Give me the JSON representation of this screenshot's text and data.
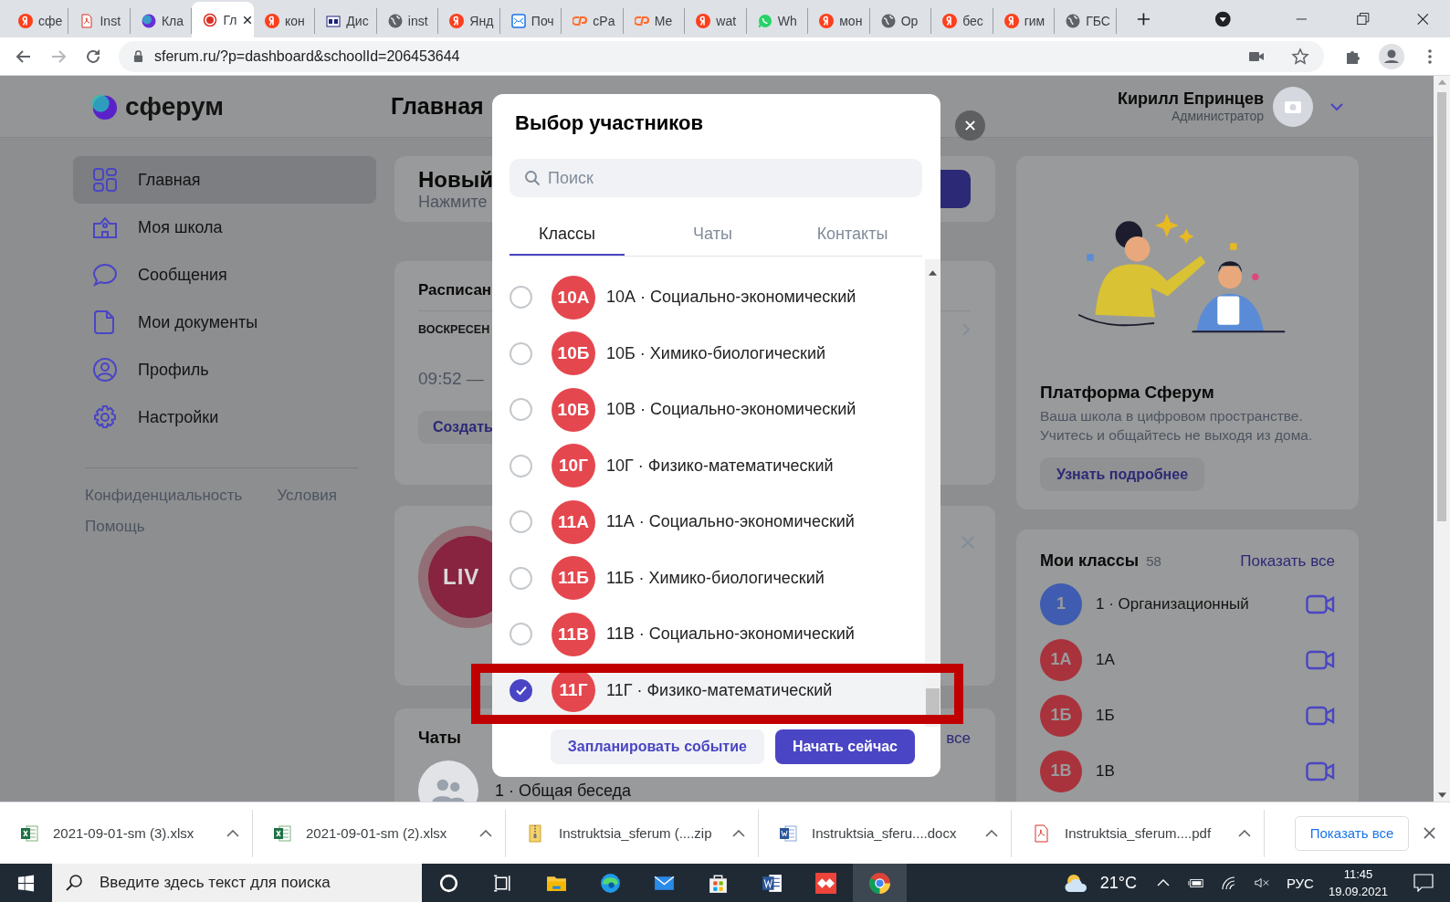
{
  "browser": {
    "tabs": [
      {
        "kind": "yandex",
        "label": "сфе",
        "selected": false
      },
      {
        "kind": "pdf",
        "label": "Inst",
        "selected": false
      },
      {
        "kind": "sferum",
        "label": "Кла",
        "selected": false
      },
      {
        "kind": "recording",
        "label": "Гл",
        "selected": true
      },
      {
        "kind": "yandex",
        "label": "кон",
        "selected": false
      },
      {
        "kind": "calendar",
        "label": "Дис",
        "selected": false
      },
      {
        "kind": "globe",
        "label": "inst",
        "selected": false
      },
      {
        "kind": "yandex",
        "label": "Янд",
        "selected": false
      },
      {
        "kind": "mail",
        "label": "Поч",
        "selected": false
      },
      {
        "kind": "cpanel",
        "label": "cPa",
        "selected": false
      },
      {
        "kind": "cpanel",
        "label": "Ме",
        "selected": false
      },
      {
        "kind": "yandex",
        "label": "wat",
        "selected": false
      },
      {
        "kind": "whatsapp",
        "label": "Wh",
        "selected": false
      },
      {
        "kind": "yandex",
        "label": "мон",
        "selected": false
      },
      {
        "kind": "globe",
        "label": "Ор",
        "selected": false
      },
      {
        "kind": "yandex",
        "label": "бес",
        "selected": false
      },
      {
        "kind": "yandex",
        "label": "гим",
        "selected": false
      },
      {
        "kind": "globe",
        "label": "ГБС",
        "selected": false
      }
    ],
    "address": "sferum.ru/?p=dashboard&schoolId=206453644"
  },
  "page": {
    "logo": "сферум",
    "title": "Главная",
    "user": {
      "name": "Кирилл Епринцев",
      "role": "Администратор"
    },
    "sidebar": {
      "items": [
        {
          "kind": "grid",
          "label": "Главная",
          "selected": true
        },
        {
          "kind": "school",
          "label": "Моя школа",
          "selected": false
        },
        {
          "kind": "chat",
          "label": "Сообщения",
          "selected": false
        },
        {
          "kind": "document",
          "label": "Мои документы",
          "selected": false
        },
        {
          "kind": "profile",
          "label": "Профиль",
          "selected": false
        },
        {
          "kind": "settings",
          "label": "Настройки",
          "selected": false
        }
      ],
      "links": [
        "Конфиденциальность",
        "Условия",
        "Помощь"
      ]
    },
    "new_call": {
      "title": "Новый",
      "hint": "Нажмите"
    },
    "schedule": {
      "title": "Расписан",
      "day": "ВОСКРЕСЕН",
      "time": "09:52 —",
      "button": "Создать"
    },
    "live": {
      "badge": "LIV"
    },
    "chats": {
      "title": "Чаты",
      "link": "все",
      "first": "1 · Общая беседа"
    },
    "promo": {
      "title": "Платформа Сферум",
      "text": "Ваша школа в цифровом пространстве. Учитесь и общайтесь не выходя из дома.",
      "button": "Узнать подробнее"
    },
    "classes": {
      "title": "Мои классы",
      "count": "58",
      "link": "Показать все",
      "items": [
        {
          "badge": "1",
          "name": "1 · Организационный",
          "color": "#3f5cb0"
        },
        {
          "badge": "1А",
          "name": "1А",
          "color": "#a8333c"
        },
        {
          "badge": "1Б",
          "name": "1Б",
          "color": "#a8333c"
        },
        {
          "badge": "1В",
          "name": "1В",
          "color": "#a8333c"
        }
      ]
    }
  },
  "dialog": {
    "title": "Выбор участников",
    "search_placeholder": "Поиск",
    "tabs": [
      {
        "label": "Классы",
        "selected": true
      },
      {
        "label": "Чаты",
        "selected": false
      },
      {
        "label": "Контакты",
        "selected": false
      }
    ],
    "rows": [
      {
        "badge": "10А",
        "name": "10А · Социально-экономический",
        "checked": false
      },
      {
        "badge": "10Б",
        "name": "10Б · Химико-биологический",
        "checked": false
      },
      {
        "badge": "10В",
        "name": "10В · Социально-экономический",
        "checked": false
      },
      {
        "badge": "10Г",
        "name": "10Г · Физико-математический",
        "checked": false
      },
      {
        "badge": "11А",
        "name": "11А · Социально-экономический",
        "checked": false
      },
      {
        "badge": "11Б",
        "name": "11Б · Химико-биологический",
        "checked": false
      },
      {
        "badge": "11В",
        "name": "11В · Социально-экономический",
        "checked": false
      },
      {
        "badge": "11Г",
        "name": "11Г · Физико-математический",
        "checked": true
      }
    ],
    "buttons": [
      {
        "kind": "secondary",
        "label": "Запланировать событие"
      },
      {
        "kind": "primary",
        "label": "Начать сейчас"
      }
    ]
  },
  "downloads": {
    "items": [
      {
        "kind": "excel",
        "name": "2021-09-01-sm (3).xlsx"
      },
      {
        "kind": "excel",
        "name": "2021-09-01-sm (2).xlsx"
      },
      {
        "kind": "zip",
        "name": "Instruktsia_sferum (....zip"
      },
      {
        "kind": "word",
        "name": "Instruktsia_sferu....docx"
      },
      {
        "kind": "pdf",
        "name": "Instruktsia_sferum....pdf"
      }
    ],
    "show_all": "Показать все"
  },
  "taskbar": {
    "search_placeholder": "Введите здесь текст для поиска",
    "apps": [
      {
        "kind": "cortana",
        "selected": false
      },
      {
        "kind": "taskview",
        "selected": false
      },
      {
        "kind": "explorer",
        "selected": false
      },
      {
        "kind": "edge",
        "selected": false
      },
      {
        "kind": "mail",
        "selected": false
      },
      {
        "kind": "store",
        "selected": false
      },
      {
        "kind": "word",
        "selected": false
      },
      {
        "kind": "anydesk",
        "selected": false
      },
      {
        "kind": "chrome",
        "selected": true
      }
    ],
    "weather": "21°C",
    "language": "РУС",
    "time": "11:45",
    "date": "19.09.2021"
  }
}
